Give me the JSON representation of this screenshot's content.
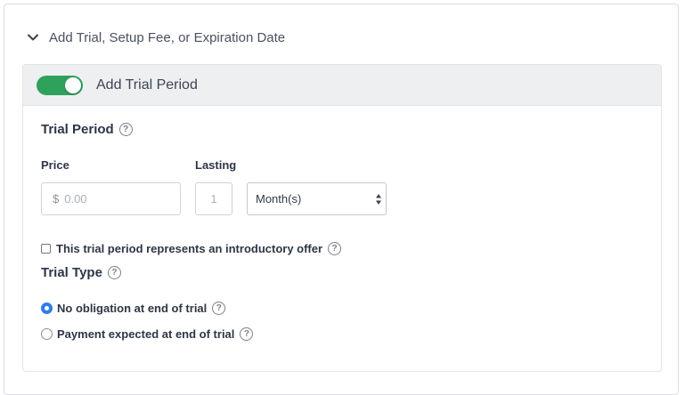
{
  "section": {
    "title": "Add Trial, Setup Fee, or Expiration Date"
  },
  "trial_toggle": {
    "label": "Add Trial Period",
    "enabled": true,
    "color": "#2ea15b"
  },
  "trial_period": {
    "heading": "Trial Period",
    "price_label": "Price",
    "currency_symbol": "$",
    "price_placeholder": "0.00",
    "price_value": "",
    "lasting_label": "Lasting",
    "lasting_placeholder": "1",
    "lasting_value": "",
    "unit_selected": "Month(s)"
  },
  "intro_offer": {
    "label": "This trial period represents an introductory offer",
    "checked": false
  },
  "trial_type": {
    "heading": "Trial Type",
    "options": [
      {
        "label": "No obligation at end of trial",
        "selected": true
      },
      {
        "label": "Payment expected at end of trial",
        "selected": false
      }
    ]
  },
  "help_glyph": "?",
  "icons": {
    "section_toggle": "chevron-down-icon",
    "help": "question-circle-icon",
    "select_arrows": "sort-arrows-icon"
  },
  "colors": {
    "accent_radio": "#2f7ee6",
    "toggle_on": "#2ea15b"
  }
}
